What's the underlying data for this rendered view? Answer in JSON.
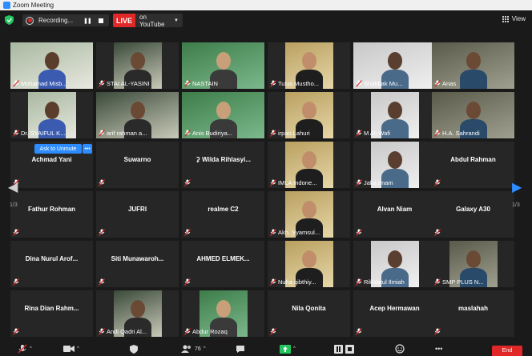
{
  "window": {
    "title": "Zoom Meeting"
  },
  "topbar": {
    "recording_label": "Recording...",
    "live_badge": "LIVE",
    "live_target": "on YouTube",
    "view_label": "View"
  },
  "overlay": {
    "ask_to_unmute": "Ask to Unmute",
    "more": "•••"
  },
  "pagination": {
    "left": "1/3",
    "right": "1/3"
  },
  "tiles": [
    {
      "name": "Mohamad Misb...",
      "video": true
    },
    {
      "name": "STAI AL-YASINI",
      "video": true
    },
    {
      "name": "NASTAIN",
      "video": true
    },
    {
      "name": "Tulus Mustho...",
      "video": true
    },
    {
      "name": "Shabbak Mu...",
      "video": true
    },
    {
      "name": "Anas",
      "video": true,
      "active": true
    },
    {
      "name": "Dr. SYAIFUL K...",
      "video": true
    },
    {
      "name": "arif rahman a...",
      "video": true
    },
    {
      "name": "Anis Budiriya...",
      "video": true
    },
    {
      "name": "irpan Lahuri",
      "video": true
    },
    {
      "name": "M Ali Wafi",
      "video": true
    },
    {
      "name": "H.A. Sahrandi",
      "video": true
    },
    {
      "name": "Achmad Yani",
      "video": false
    },
    {
      "name": "Suwarno",
      "video": false
    },
    {
      "name": "⚳ Wilda  Rihlasyi...",
      "video": false
    },
    {
      "name": "IMLA Indone...",
      "video": true
    },
    {
      "name": "Jaka Imam",
      "video": true
    },
    {
      "name": "Abdul  Rahman",
      "video": false
    },
    {
      "name": "Fathur Rohman",
      "video": false
    },
    {
      "name": "JUFRI",
      "video": false
    },
    {
      "name": "realme C2",
      "video": false
    },
    {
      "name": "Akh. Syamsul...",
      "video": true
    },
    {
      "name": "Alvan Niam",
      "video": false
    },
    {
      "name": "Galaxy A30",
      "video": false
    },
    {
      "name": "Dina Nurul Arof...",
      "video": false
    },
    {
      "name": "Siti  Munawaroh...",
      "video": false
    },
    {
      "name": "AHMED  ELMEK...",
      "video": false
    },
    {
      "name": "Nuha qibthiy...",
      "video": true
    },
    {
      "name": "Rikhlatul Ilmiah",
      "video": true
    },
    {
      "name": "SMP PLUS N...",
      "video": true
    },
    {
      "name": "Rina  Dian  Rahm...",
      "video": false
    },
    {
      "name": "Andi Qadri Al...",
      "video": true
    },
    {
      "name": "Abdur Rozaq",
      "video": true
    },
    {
      "name": "Nila Qonita",
      "video": false
    },
    {
      "name": "Acep Hermawan",
      "video": false
    },
    {
      "name": "maslahah",
      "video": false
    }
  ],
  "toolbar": {
    "participants_count": "76",
    "end_label": "End"
  },
  "colors": {
    "zoom_blue": "#2d8cff",
    "live_red": "#e02828",
    "active_speaker": "#d4d44a",
    "tile_bg": "#262626"
  }
}
